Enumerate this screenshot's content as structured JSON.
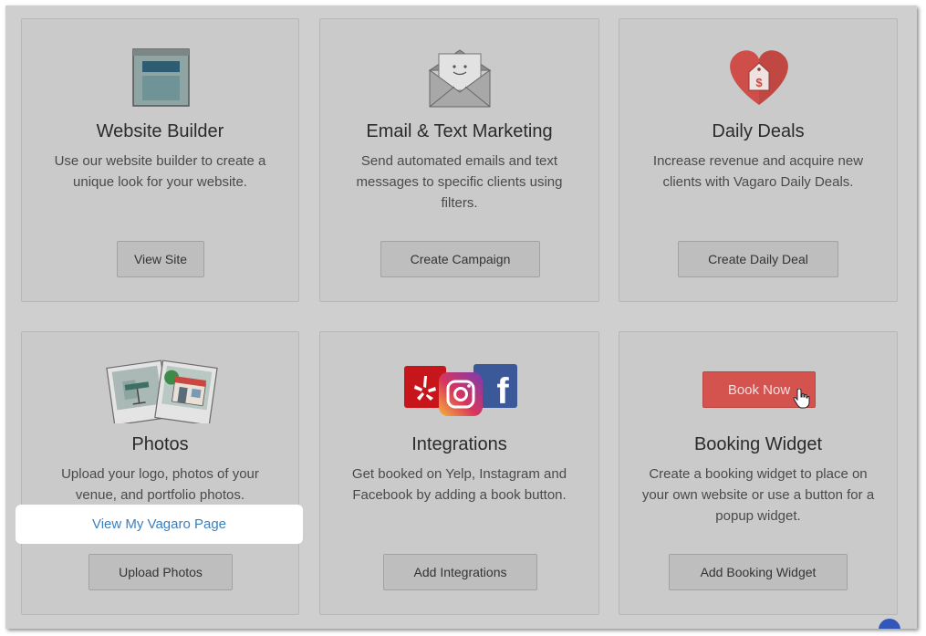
{
  "cards": [
    {
      "title": "Website Builder",
      "description": "Use our website builder to create a unique look for your website.",
      "button": "View Site",
      "icon": "website-icon"
    },
    {
      "title": "Email & Text Marketing",
      "description": "Send automated emails and text messages to specific clients using filters.",
      "button": "Create Campaign",
      "icon": "envelope-icon"
    },
    {
      "title": "Daily Deals",
      "description": "Increase revenue and acquire new clients with Vagaro Daily Deals.",
      "button": "Create Daily Deal",
      "icon": "heart-price-tag-icon",
      "icon_text": "$"
    },
    {
      "title": "Photos",
      "description": "Upload your logo, photos of your venue, and portfolio photos.",
      "link": "View My Vagaro Page",
      "button": "Upload Photos",
      "icon": "photos-icon"
    },
    {
      "title": "Integrations",
      "description": "Get booked on Yelp, Instagram and Facebook by adding a book button.",
      "button": "Add Integrations",
      "icon": "social-logos-icon",
      "facebook_letter": "f"
    },
    {
      "title": "Booking Widget",
      "description": "Create a booking widget to place on your own website or use a button for a popup widget.",
      "button": "Add Booking Widget",
      "preview_button": "Book Now",
      "icon": "book-now-button-icon"
    }
  ],
  "colors": {
    "overlay": "#cfcfcf",
    "card": "#cacaca",
    "button": "#bebebe",
    "link": "#3a7fc0",
    "book_now": "#d4534e",
    "heart": "#d4534e"
  }
}
